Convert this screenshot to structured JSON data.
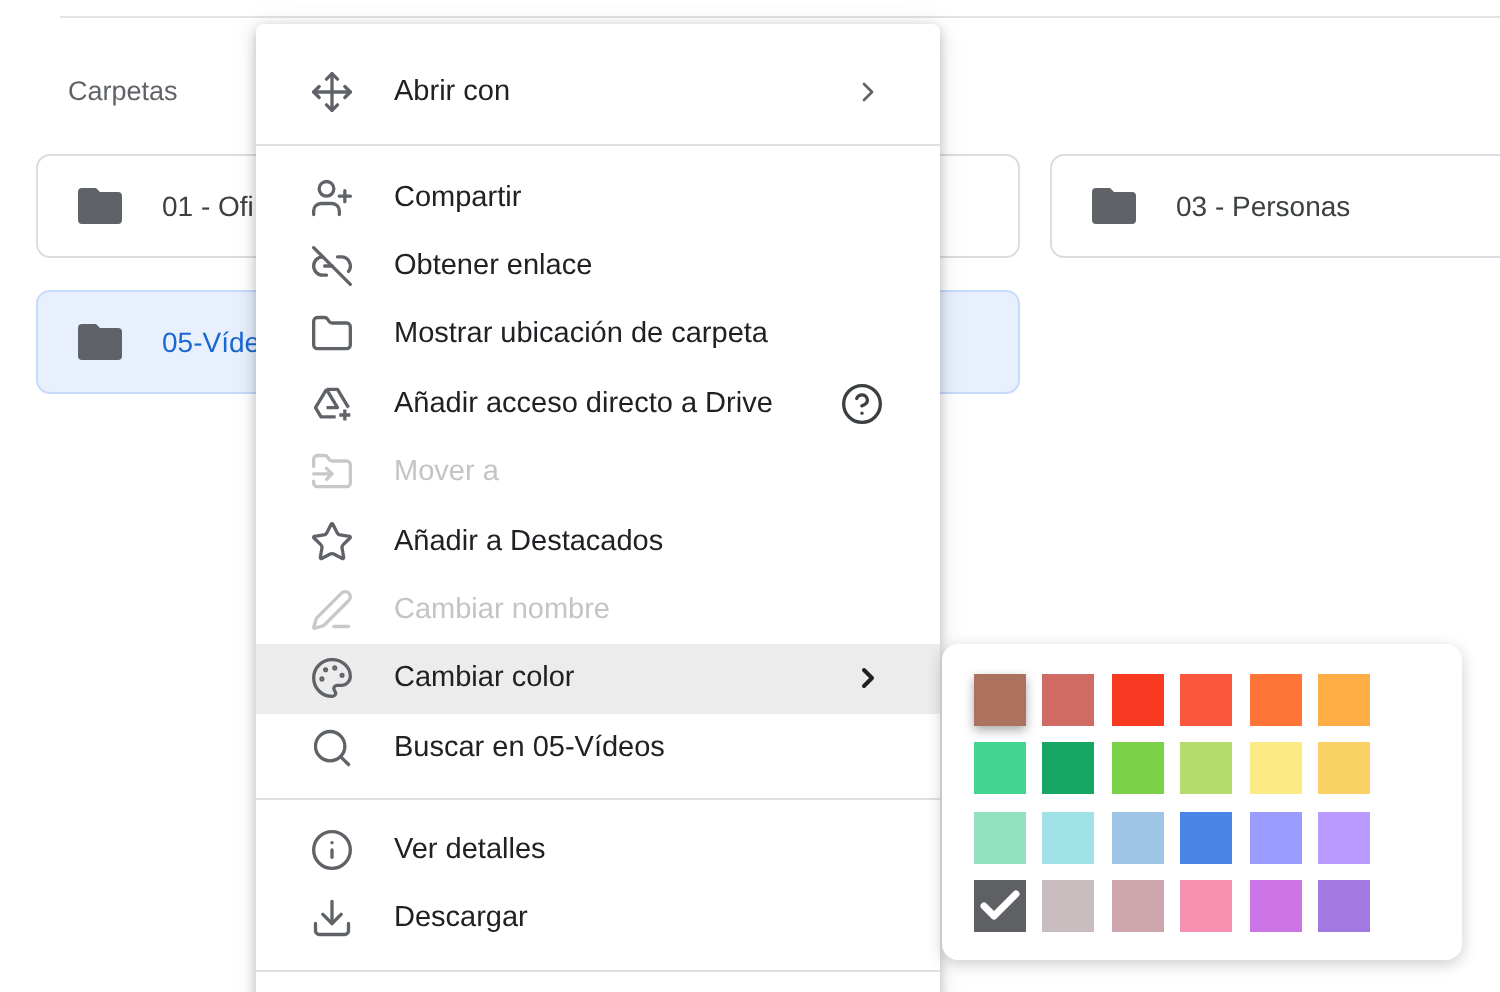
{
  "section_title": "Carpetas",
  "folders": [
    {
      "name": "01 - Ofi",
      "selected": false
    },
    {
      "name": "03 - Personas",
      "selected": false
    },
    {
      "name": "05-Víde",
      "selected": true
    }
  ],
  "context_menu": {
    "sections": [
      [
        {
          "label": "Abrir con",
          "disabled": false,
          "highlighted": false,
          "has_submenu": true,
          "help": false
        }
      ],
      [
        {
          "label": "Compartir",
          "disabled": false,
          "highlighted": false,
          "has_submenu": false,
          "help": false
        },
        {
          "label": "Obtener enlace",
          "disabled": false,
          "highlighted": false,
          "has_submenu": false,
          "help": false
        },
        {
          "label": "Mostrar ubicación de carpeta",
          "disabled": false,
          "highlighted": false,
          "has_submenu": false,
          "help": false
        },
        {
          "label": "Añadir acceso directo a Drive",
          "disabled": false,
          "highlighted": false,
          "has_submenu": false,
          "help": true
        },
        {
          "label": "Mover a",
          "disabled": true,
          "highlighted": false,
          "has_submenu": false,
          "help": false
        },
        {
          "label": "Añadir a Destacados",
          "disabled": false,
          "highlighted": false,
          "has_submenu": false,
          "help": false
        },
        {
          "label": "Cambiar nombre",
          "disabled": true,
          "highlighted": false,
          "has_submenu": false,
          "help": false
        },
        {
          "label": "Cambiar color",
          "disabled": false,
          "highlighted": true,
          "has_submenu": true,
          "help": false
        },
        {
          "label": "Buscar en 05-Vídeos",
          "disabled": false,
          "highlighted": false,
          "has_submenu": false,
          "help": false
        }
      ],
      [
        {
          "label": "Ver detalles",
          "disabled": false,
          "highlighted": false,
          "has_submenu": false,
          "help": false
        },
        {
          "label": "Descargar",
          "disabled": false,
          "highlighted": false,
          "has_submenu": false,
          "help": false
        }
      ]
    ]
  },
  "color_palette": [
    {
      "color": "#ac725e",
      "selected": false,
      "hovered": true
    },
    {
      "color": "#d06b64",
      "selected": false,
      "hovered": false
    },
    {
      "color": "#f83a22",
      "selected": false,
      "hovered": false
    },
    {
      "color": "#fa573c",
      "selected": false,
      "hovered": false
    },
    {
      "color": "#ff7537",
      "selected": false,
      "hovered": false
    },
    {
      "color": "#ffad46",
      "selected": false,
      "hovered": false
    },
    {
      "color": "#42d692",
      "selected": false,
      "hovered": false
    },
    {
      "color": "#16a765",
      "selected": false,
      "hovered": false
    },
    {
      "color": "#7bd148",
      "selected": false,
      "hovered": false
    },
    {
      "color": "#b3dc6c",
      "selected": false,
      "hovered": false
    },
    {
      "color": "#fbe983",
      "selected": false,
      "hovered": false
    },
    {
      "color": "#fad165",
      "selected": false,
      "hovered": false
    },
    {
      "color": "#92e1c0",
      "selected": false,
      "hovered": false
    },
    {
      "color": "#9fe1e7",
      "selected": false,
      "hovered": false
    },
    {
      "color": "#9fc6e7",
      "selected": false,
      "hovered": false
    },
    {
      "color": "#4986e7",
      "selected": false,
      "hovered": false
    },
    {
      "color": "#9a9cff",
      "selected": false,
      "hovered": false
    },
    {
      "color": "#b99aff",
      "selected": false,
      "hovered": false
    },
    {
      "color": "#5f6064",
      "selected": true,
      "hovered": false
    },
    {
      "color": "#cabdbf",
      "selected": false,
      "hovered": false
    },
    {
      "color": "#cca6ac",
      "selected": false,
      "hovered": false
    },
    {
      "color": "#f691b2",
      "selected": false,
      "hovered": false
    },
    {
      "color": "#cd74e6",
      "selected": false,
      "hovered": false
    },
    {
      "color": "#a47ae2",
      "selected": false,
      "hovered": false
    }
  ]
}
